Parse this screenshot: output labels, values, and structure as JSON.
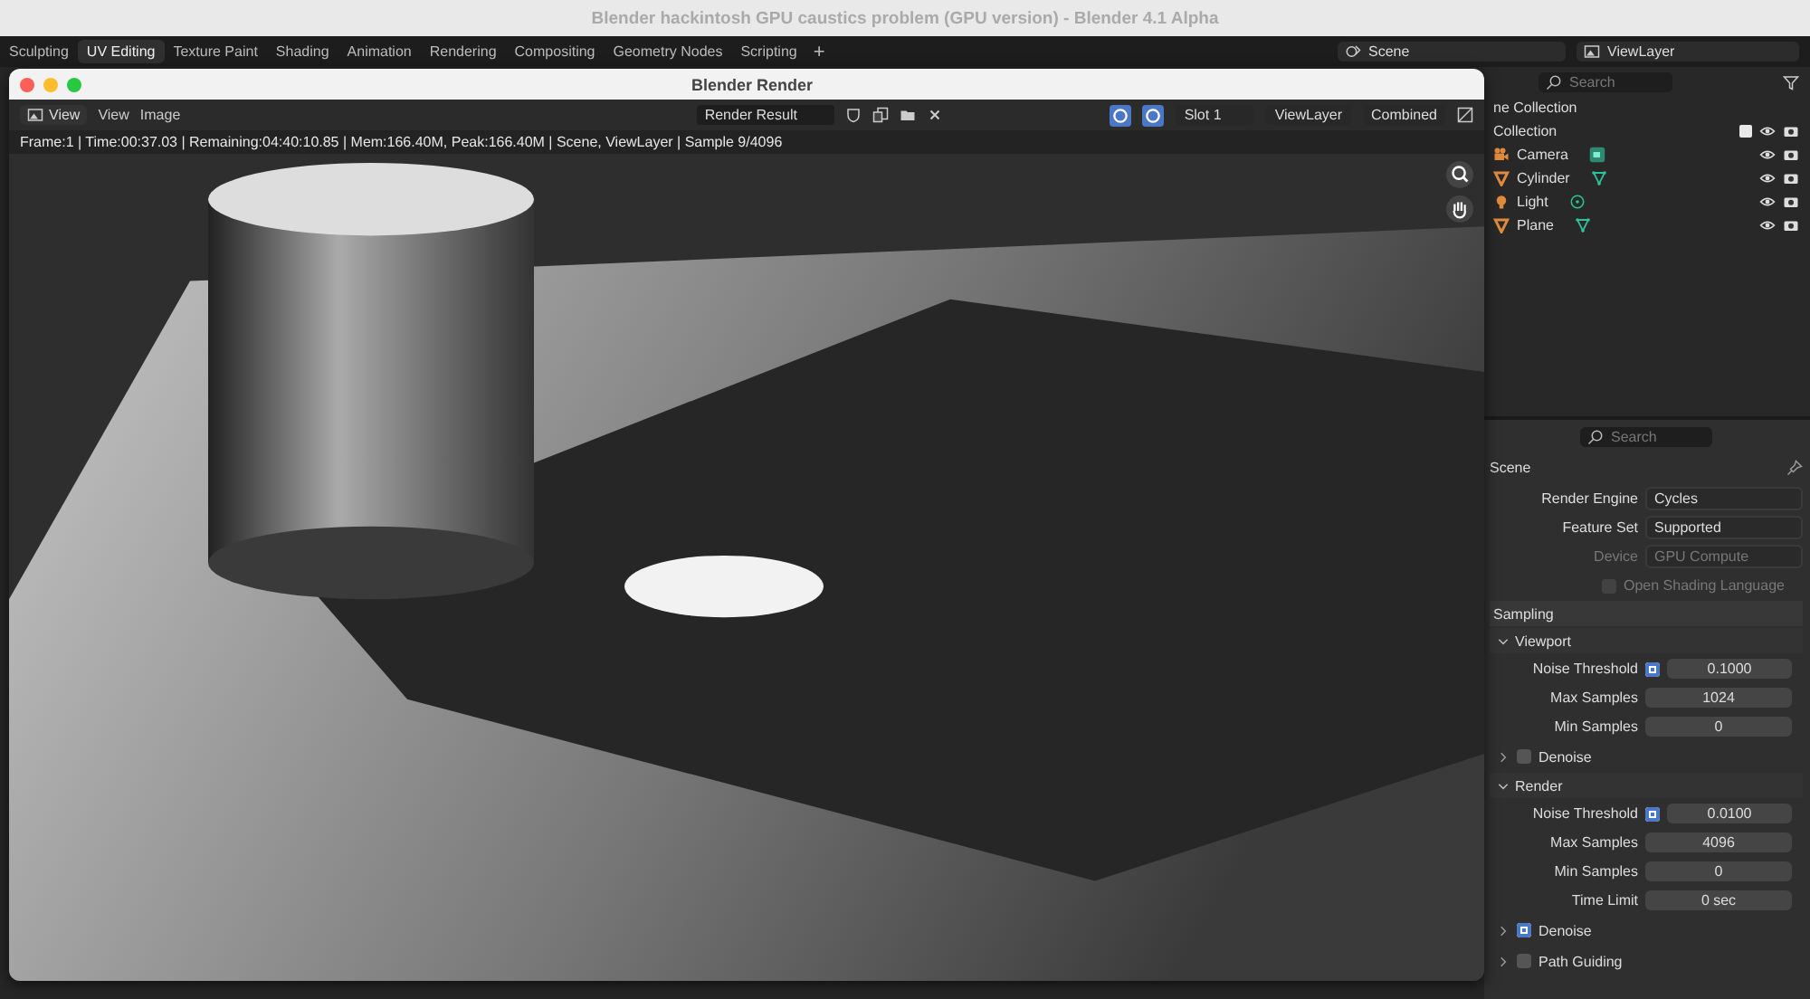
{
  "app_title": "Blender hackintosh GPU caustics problem (GPU version) - Blender 4.1 Alpha",
  "workspace_tabs": [
    {
      "label": "Sculpting",
      "selected": false
    },
    {
      "label": "UV Editing",
      "selected": true
    },
    {
      "label": "Texture Paint",
      "selected": false
    },
    {
      "label": "Shading",
      "selected": false
    },
    {
      "label": "Animation",
      "selected": false
    },
    {
      "label": "Rendering",
      "selected": false
    },
    {
      "label": "Compositing",
      "selected": false
    },
    {
      "label": "Geometry Nodes",
      "selected": false
    },
    {
      "label": "Scripting",
      "selected": false
    }
  ],
  "add_workspace": "+",
  "scene_selector": "Scene",
  "view_layer_selector": "ViewLayer",
  "render_window": {
    "title": "Blender Render",
    "view_dropdown": "View",
    "menus": [
      "View",
      "Image"
    ],
    "image_name": "Render Result",
    "toggles": [
      {
        "active": true
      },
      {
        "active": true
      }
    ],
    "slot": "Slot 1",
    "layer": "ViewLayer",
    "pass": "Combined",
    "status": "Frame:1 | Time:00:37.03 | Remaining:04:40:10.85 | Mem:166.40M, Peak:166.40M | Scene, ViewLayer | Sample 9/4096"
  },
  "outliner": {
    "search_placeholder": "Search",
    "scene_collection": "ne Collection",
    "collection": "Collection",
    "collection_checked": true,
    "items": [
      {
        "name": "Camera",
        "kind": "camera"
      },
      {
        "name": "Cylinder",
        "kind": "mesh"
      },
      {
        "name": "Light",
        "kind": "light"
      },
      {
        "name": "Plane",
        "kind": "mesh"
      }
    ]
  },
  "properties": {
    "search_placeholder": "Search",
    "context": "Scene",
    "rows": [
      {
        "label": "Render Engine",
        "value": "Cycles",
        "disabled": false
      },
      {
        "label": "Feature Set",
        "value": "Supported",
        "disabled": false
      },
      {
        "label": "Device",
        "value": "GPU Compute",
        "disabled": true
      }
    ],
    "osl": {
      "label": "Open Shading Language",
      "checked": false,
      "disabled": true
    },
    "sampling": {
      "title": "Sampling",
      "subpanels": [
        {
          "title": "Viewport",
          "expanded": true,
          "fields": [
            {
              "label": "Noise Threshold",
              "value": "0.1000",
              "checked": true
            },
            {
              "label": "Max Samples",
              "value": "1024"
            },
            {
              "label": "Min Samples",
              "value": "0"
            }
          ],
          "denoise": {
            "label": "Denoise",
            "checked": false
          }
        },
        {
          "title": "Render",
          "expanded": true,
          "fields": [
            {
              "label": "Noise Threshold",
              "value": "0.0100",
              "checked": true
            },
            {
              "label": "Max Samples",
              "value": "4096"
            },
            {
              "label": "Min Samples",
              "value": "0"
            },
            {
              "label": "Time Limit",
              "value": "0 sec"
            }
          ],
          "denoise": {
            "label": "Denoise",
            "checked": true
          }
        }
      ]
    },
    "path_guiding": {
      "label": "Path Guiding",
      "checked": false
    }
  }
}
